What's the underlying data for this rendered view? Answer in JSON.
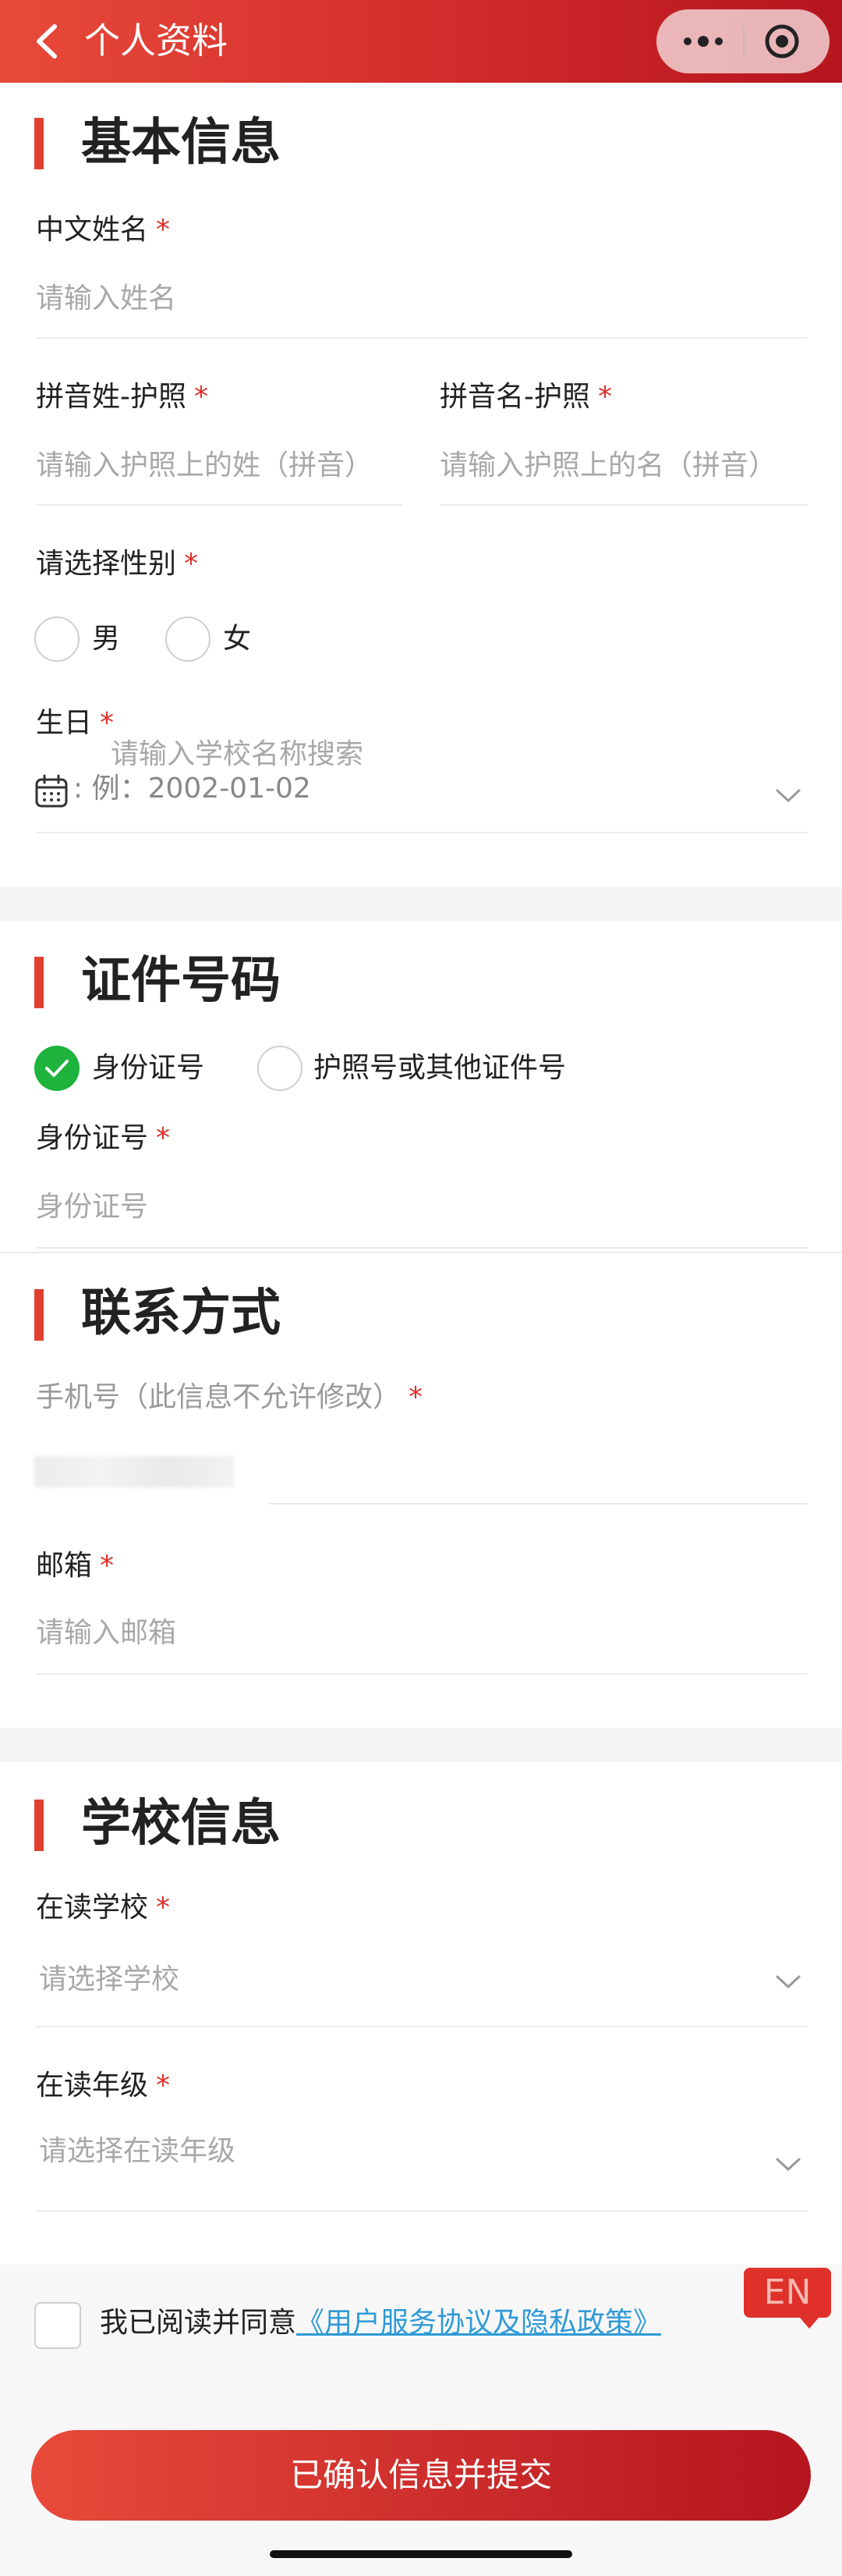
{
  "header": {
    "title": "个人资料"
  },
  "basic": {
    "title": "基本信息",
    "chinese_name": {
      "label": "中文姓名",
      "required": "*",
      "placeholder": "请输入姓名"
    },
    "surname": {
      "label": "拼音姓-护照",
      "required": "*",
      "placeholder": "请输入护照上的姓（拼音）"
    },
    "given_name": {
      "label": "拼音名-护照",
      "required": "*",
      "placeholder": "请输入护照上的名（拼音）"
    },
    "gender": {
      "label": "请选择性别",
      "required": "*",
      "options": [
        "男",
        "女"
      ]
    },
    "birthday": {
      "label": "生日",
      "required": "*",
      "overlay_hint": "请输入学校名称搜索",
      "placeholder": ": 例：2002-01-02"
    }
  },
  "id": {
    "title": "证件号码",
    "options": [
      "身份证号",
      "护照号或其他证件号"
    ],
    "selected": "身份证号",
    "field": {
      "label": "身份证号",
      "required": "*",
      "placeholder": "身份证号"
    }
  },
  "contact": {
    "title": "联系方式",
    "phone": {
      "label": "手机号（此信息不允许修改）",
      "required": "*"
    },
    "email": {
      "label": "邮箱",
      "required": "*",
      "placeholder": "请输入邮箱"
    }
  },
  "school": {
    "title": "学校信息",
    "school": {
      "label": "在读学校",
      "required": "*",
      "placeholder": "请选择学校"
    },
    "grade": {
      "label": "在读年级",
      "required": "*",
      "placeholder": "请选择在读年级"
    }
  },
  "agreement": {
    "prefix": "我已阅读并同意",
    "link": "《用户服务协议及隐私政策》"
  },
  "lang_badge": "EN",
  "submit_label": "已确认信息并提交",
  "colors": {
    "brand_red": "#d12b2b",
    "accent_bar": "#e0402f",
    "check_green": "#1db33c",
    "link_blue": "#2f9ad6"
  }
}
